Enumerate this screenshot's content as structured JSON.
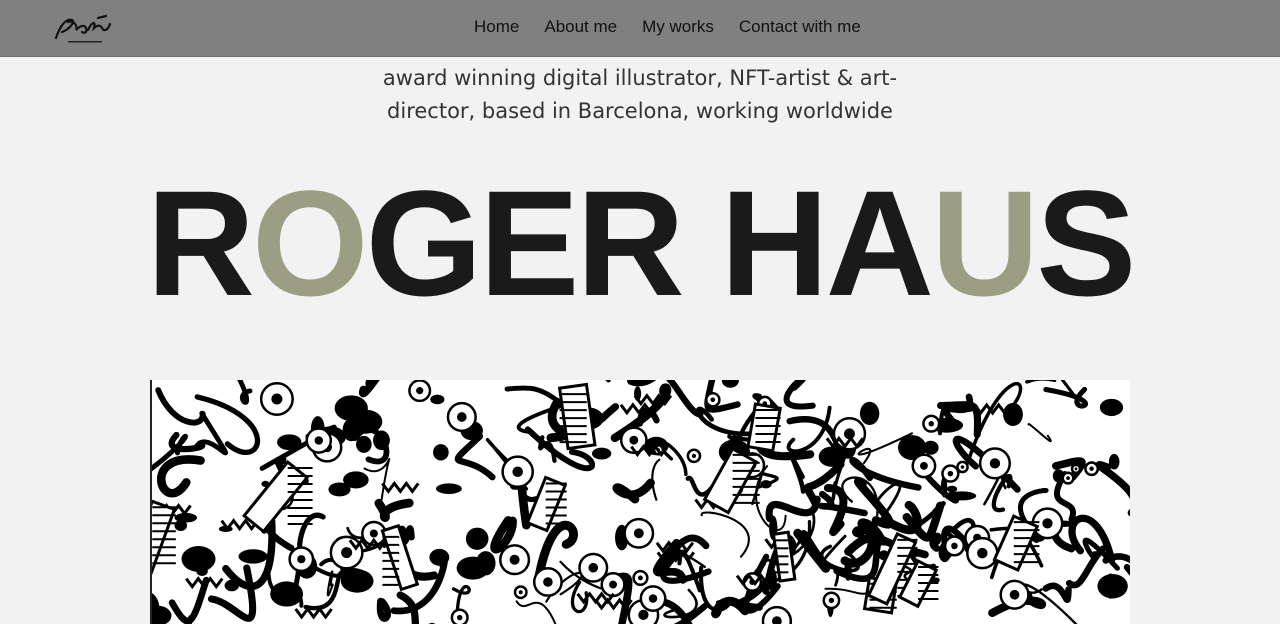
{
  "nav": {
    "logo_icon": "signature-logo",
    "links": [
      "Home",
      "About me",
      "My works",
      "Contact with me"
    ]
  },
  "hero": {
    "tagline_line1": "award winning digital illustrator, NFT-artist & art-",
    "tagline_line2": "director, based in Barcelona, working worldwide",
    "title_parts": [
      "R",
      "O",
      "GER HA",
      "U",
      "S"
    ],
    "accent_color": "#9b9e82",
    "text_color": "#1a1a1a"
  },
  "artwork": {
    "description_icon": "doodle-illustration"
  }
}
